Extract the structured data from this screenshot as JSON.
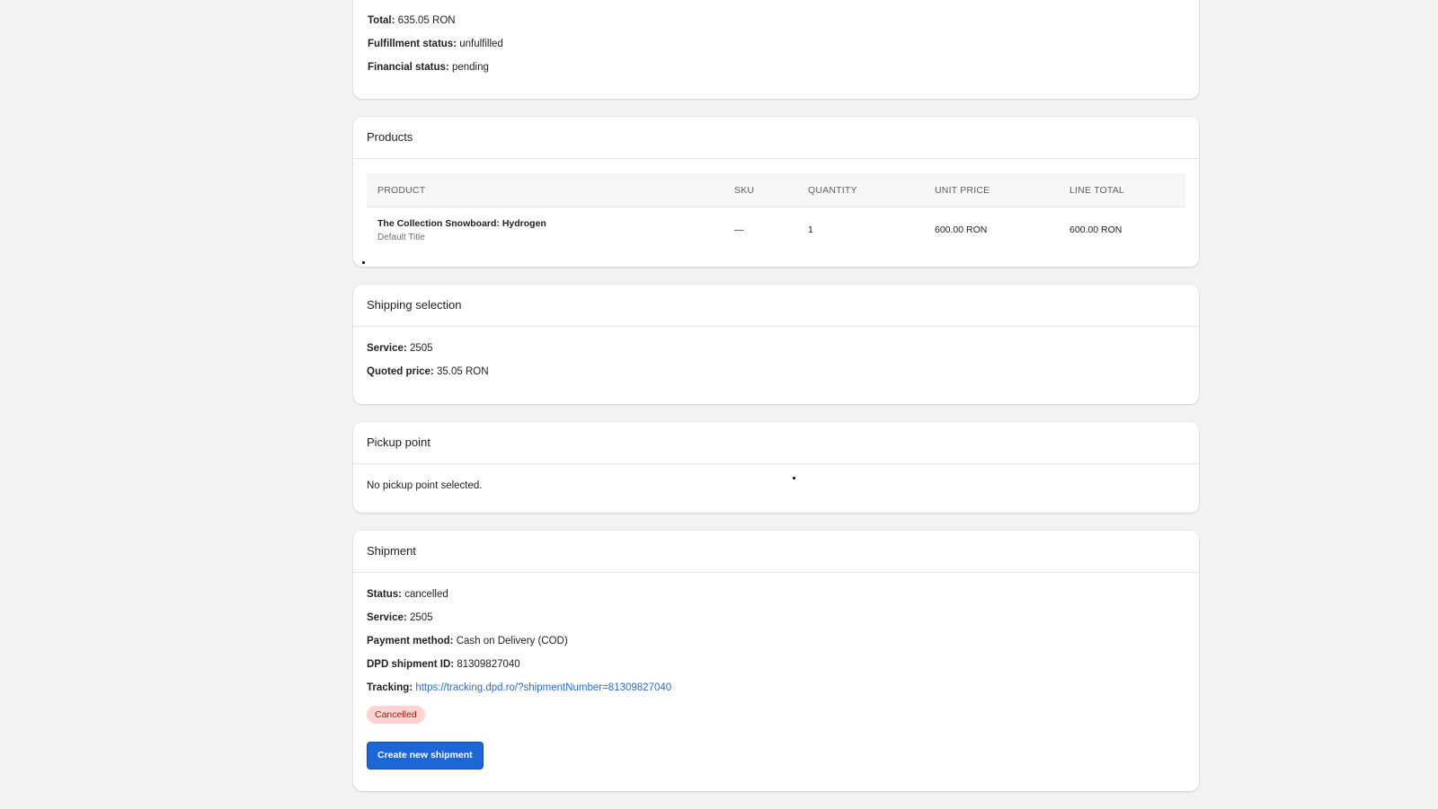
{
  "summary": {
    "total_label": "Total:",
    "total_value": "635.05 RON",
    "fulfillment_label": "Fulfillment status:",
    "fulfillment_value": "unfulfilled",
    "financial_label": "Financial status:",
    "financial_value": "pending"
  },
  "products": {
    "title": "Products",
    "columns": [
      "PRODUCT",
      "SKU",
      "QUANTITY",
      "UNIT PRICE",
      "LINE TOTAL"
    ],
    "rows": [
      {
        "title": "The Collection Snowboard: Hydrogen",
        "variant": "Default Title",
        "sku": "—",
        "quantity": "1",
        "unit_price": "600.00 RON",
        "line_total": "600.00 RON"
      }
    ]
  },
  "shipping_selection": {
    "title": "Shipping selection",
    "service_label": "Service:",
    "service_value": "2505",
    "price_label": "Quoted price:",
    "price_value": "35.05 RON"
  },
  "pickup_point": {
    "title": "Pickup point",
    "message": "No pickup point selected."
  },
  "shipment": {
    "title": "Shipment",
    "status_label": "Status:",
    "status_value": "cancelled",
    "service_label": "Service:",
    "service_value": "2505",
    "payment_label": "Payment method:",
    "payment_value": "Cash on Delivery (COD)",
    "dpd_label": "DPD shipment ID:",
    "dpd_value": "81309827040",
    "tracking_label": "Tracking:",
    "tracking_url": "https://tracking.dpd.ro/?shipmentNumber=81309827040",
    "badge": "Cancelled",
    "create_button": "Create new shipment"
  },
  "colors": {
    "background": "#f1f2f4",
    "primary_button": "#1d66d6",
    "link": "#2c6ecb",
    "badge_bg": "#fed3d1",
    "badge_text": "#8e1f0b"
  }
}
